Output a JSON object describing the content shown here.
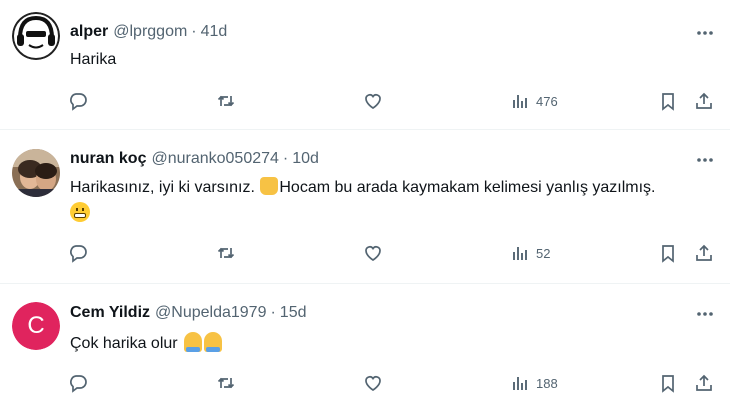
{
  "tweets": [
    {
      "name": "alper",
      "handle": "@lprggom",
      "separator": "·",
      "time": "41d",
      "text": "Harika",
      "views": "476",
      "avatar_icon": "headphones-face-icon"
    },
    {
      "name": "nuran koç",
      "handle": "@nuranko050274",
      "separator": "·",
      "time": "10d",
      "text_part1": "Harikasınız, iyi ki varsınız. ",
      "text_part2": "Hocam bu arada kaymakam kelimesi yanlış yazılmış. ",
      "views": "52",
      "avatar_icon": "photo-avatar"
    },
    {
      "name": "Cem Yildiz",
      "handle": "@Nupelda1979",
      "separator": "·",
      "time": "15d",
      "text": "Çok harika olur ",
      "views": "188",
      "avatar_letter": "C",
      "avatar_color": "#e0245e"
    }
  ],
  "colors": {
    "text": "#0f1419",
    "muted": "#536471",
    "divider": "#eff3f4"
  }
}
